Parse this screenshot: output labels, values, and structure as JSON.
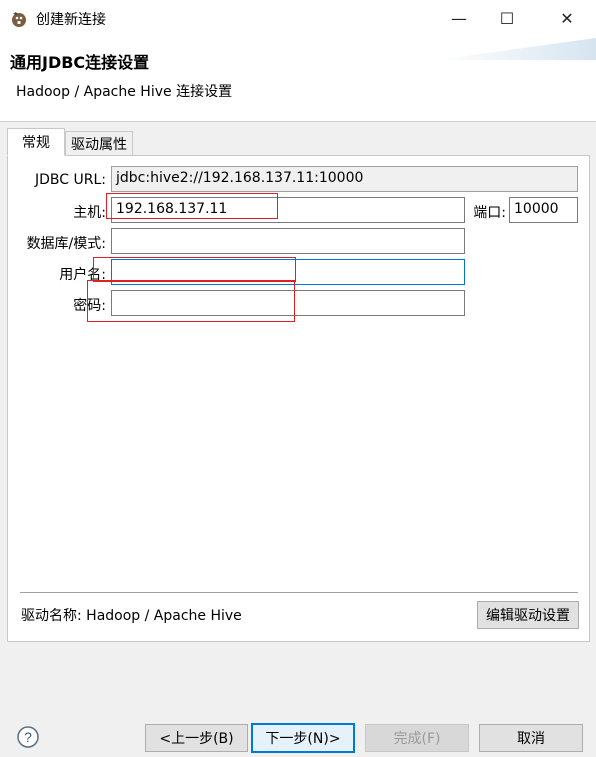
{
  "window": {
    "title": "创建新连接",
    "minimize_glyph": "—",
    "maximize_glyph": "☐",
    "close_glyph": "✕"
  },
  "banner": {
    "title": "通用JDBC连接设置",
    "description": "Hadoop / Apache Hive 连接设置"
  },
  "tabs": [
    {
      "label": "常规",
      "active": true
    },
    {
      "label": "驱动属性",
      "active": false
    }
  ],
  "form": {
    "jdbc_url_label": "JDBC URL:",
    "jdbc_url_value": "jdbc:hive2://192.168.137.11:10000",
    "host_label": "主机:",
    "host_value": "192.168.137.11",
    "port_label": "端口:",
    "port_value": "10000",
    "database_label": "数据库/模式:",
    "database_value": "",
    "username_label": "用户名:",
    "username_value": "",
    "password_label": "密码:",
    "password_value": ""
  },
  "driver": {
    "name_text": "驱动名称:  Hadoop / Apache Hive",
    "edit_button": "编辑驱动设置"
  },
  "buttons": {
    "back": "<上一步(B)",
    "next": "下一步(N)>",
    "finish": "完成(F)",
    "cancel": "取消"
  },
  "icons": {
    "app": "dbeaver-beaver-icon",
    "help": "help-icon"
  },
  "colors": {
    "focus_border": "#0078d7",
    "annotation_red": "#e02020"
  }
}
